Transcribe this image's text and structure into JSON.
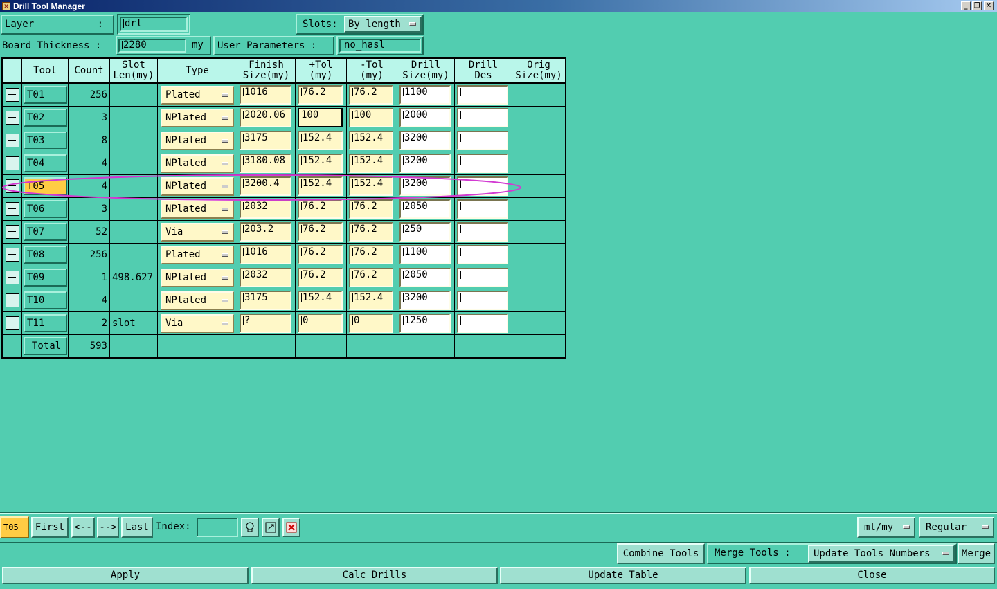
{
  "window": {
    "title": "Drill Tool Manager"
  },
  "top": {
    "layer_label": "Layer",
    "layer_colon": ":",
    "layer_value": "drl",
    "slots_label": "Slots:",
    "slots_value": "By length",
    "thickness_label": "Board Thickness :",
    "thickness_value": "2280",
    "thickness_unit": "my",
    "user_params_label": "User Parameters :",
    "user_params_value": "no_hasl"
  },
  "table": {
    "headers": [
      {
        "line1": "Tool",
        "line2": ""
      },
      {
        "line1": "Count",
        "line2": ""
      },
      {
        "line1": "Slot",
        "line2": "Len(my)"
      },
      {
        "line1": "Type",
        "line2": ""
      },
      {
        "line1": "Finish",
        "line2": "Size(my)"
      },
      {
        "line1": "+Tol",
        "line2": "(my)"
      },
      {
        "line1": "-Tol",
        "line2": "(my)"
      },
      {
        "line1": "Drill",
        "line2": "Size(my)"
      },
      {
        "line1": "Drill",
        "line2": "Des"
      },
      {
        "line1": "Orig",
        "line2": "Size(my)"
      }
    ],
    "rows": [
      {
        "tool": "T01",
        "count": "256",
        "slot": "",
        "type": "Plated",
        "finish": "1016",
        "ptol": "76.2",
        "mtol": "76.2",
        "drill": "1100",
        "des": ""
      },
      {
        "tool": "T02",
        "count": "3",
        "slot": "",
        "type": "NPlated",
        "finish": "2020.06",
        "ptol": "100",
        "mtol": "100",
        "drill": "2000",
        "des": ""
      },
      {
        "tool": "T03",
        "count": "8",
        "slot": "",
        "type": "NPlated",
        "finish": "3175",
        "ptol": "152.4",
        "mtol": "152.4",
        "drill": "3200",
        "des": ""
      },
      {
        "tool": "T04",
        "count": "4",
        "slot": "",
        "type": "NPlated",
        "finish": "3180.08",
        "ptol": "152.4",
        "mtol": "152.4",
        "drill": "3200",
        "des": ""
      },
      {
        "tool": "T05",
        "count": "4",
        "slot": "",
        "type": "NPlated",
        "finish": "3200.4",
        "ptol": "152.4",
        "mtol": "152.4",
        "drill": "3200",
        "des": ""
      },
      {
        "tool": "T06",
        "count": "3",
        "slot": "",
        "type": "NPlated",
        "finish": "2032",
        "ptol": "76.2",
        "mtol": "76.2",
        "drill": "2050",
        "des": ""
      },
      {
        "tool": "T07",
        "count": "52",
        "slot": "",
        "type": "Via",
        "finish": "203.2",
        "ptol": "76.2",
        "mtol": "76.2",
        "drill": "250",
        "des": ""
      },
      {
        "tool": "T08",
        "count": "256",
        "slot": "",
        "type": "Plated",
        "finish": "1016",
        "ptol": "76.2",
        "mtol": "76.2",
        "drill": "1100",
        "des": ""
      },
      {
        "tool": "T09",
        "count": "1",
        "slot": "498.627",
        "type": "NPlated",
        "finish": "2032",
        "ptol": "76.2",
        "mtol": "76.2",
        "drill": "2050",
        "des": ""
      },
      {
        "tool": "T10",
        "count": "4",
        "slot": "",
        "type": "NPlated",
        "finish": "3175",
        "ptol": "152.4",
        "mtol": "152.4",
        "drill": "3200",
        "des": ""
      },
      {
        "tool": "T11",
        "count": "2",
        "slot": "slot",
        "type": "Via",
        "finish": "?",
        "ptol": "0",
        "mtol": "0",
        "drill": "1250",
        "des": ""
      }
    ],
    "total_label": "Total",
    "total_count": "593",
    "selected_row": 4,
    "focused_row": 1,
    "highlight_color": "#d23ad2"
  },
  "nav": {
    "current": "T05",
    "first": "First",
    "prev": "<--",
    "next": "-->",
    "last": "Last",
    "index_label": "Index:",
    "index_value": "",
    "units": "ml/my",
    "mode": "Regular"
  },
  "actions": {
    "combine": "Combine Tools",
    "merge_label": "Merge Tools :",
    "merge_option": "Update Tools Numbers",
    "merge": "Merge",
    "apply": "Apply",
    "calc": "Calc Drills",
    "update": "Update Table",
    "close": "Close"
  },
  "colors": {
    "background": "#52cdb0",
    "selected_tool": "#ffcc44",
    "input_fill": "#fff8c8",
    "header_fill": "#b9f6ea"
  }
}
